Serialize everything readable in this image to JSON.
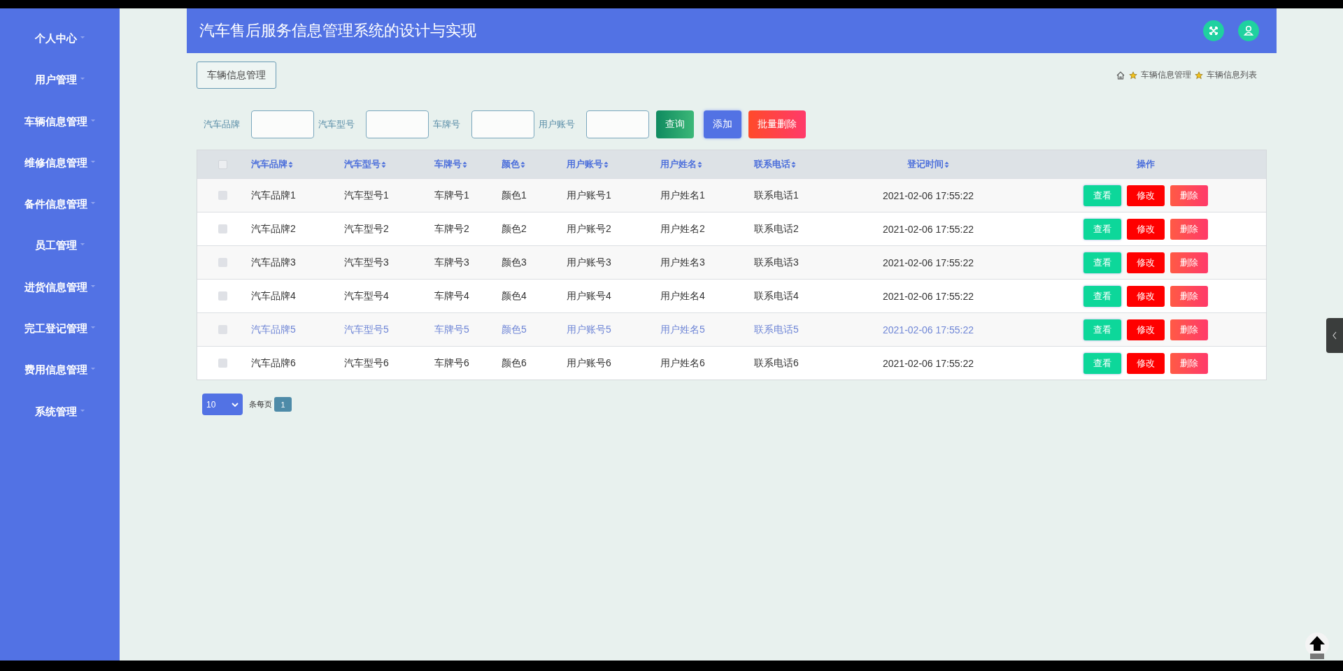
{
  "sidebar": {
    "items": [
      {
        "label": "个人中心"
      },
      {
        "label": "用户管理"
      },
      {
        "label": "车辆信息管理"
      },
      {
        "label": "维修信息管理"
      },
      {
        "label": "备件信息管理"
      },
      {
        "label": "员工管理"
      },
      {
        "label": "进货信息管理"
      },
      {
        "label": "完工登记管理"
      },
      {
        "label": "费用信息管理"
      },
      {
        "label": "系统管理"
      }
    ]
  },
  "header": {
    "title": "汽车售后服务信息管理系统的设计与实现"
  },
  "page_tab": "车辆信息管理",
  "breadcrumb": [
    "车辆信息管理",
    "车辆信息列表"
  ],
  "filters": [
    {
      "label": "汽车品牌"
    },
    {
      "label": "汽车型号"
    },
    {
      "label": "车牌号"
    },
    {
      "label": "用户账号"
    }
  ],
  "buttons": [
    {
      "kind": "search",
      "label": "查询"
    },
    {
      "kind": "add",
      "label": "添加"
    },
    {
      "kind": "delete",
      "label": "批量删除"
    }
  ],
  "table": {
    "checked": false,
    "columns": [
      "汽车品牌",
      "汽车型号",
      "车牌号",
      "颜色",
      "用户账号",
      "用户姓名",
      "联系电话",
      "登记时间",
      "操作"
    ],
    "rows": [
      {
        "checked": false,
        "hovered": false,
        "cells": [
          "汽车品牌1",
          "汽车型号1",
          "车牌号1",
          "颜色1",
          "用户账号1",
          "用户姓名1",
          "联系电话1",
          "2021-02-06 17:55:22"
        ],
        "actions": [
          {
            "kind": "view",
            "label": "查看"
          },
          {
            "kind": "edit",
            "label": "修改"
          },
          {
            "kind": "delete",
            "label": "删除"
          }
        ]
      },
      {
        "checked": false,
        "hovered": false,
        "cells": [
          "汽车品牌2",
          "汽车型号2",
          "车牌号2",
          "颜色2",
          "用户账号2",
          "用户姓名2",
          "联系电话2",
          "2021-02-06 17:55:22"
        ],
        "actions": [
          {
            "kind": "view",
            "label": "查看"
          },
          {
            "kind": "edit",
            "label": "修改"
          },
          {
            "kind": "delete",
            "label": "删除"
          }
        ]
      },
      {
        "checked": false,
        "hovered": false,
        "cells": [
          "汽车品牌3",
          "汽车型号3",
          "车牌号3",
          "颜色3",
          "用户账号3",
          "用户姓名3",
          "联系电话3",
          "2021-02-06 17:55:22"
        ],
        "actions": [
          {
            "kind": "view",
            "label": "查看"
          },
          {
            "kind": "edit",
            "label": "修改"
          },
          {
            "kind": "delete",
            "label": "删除"
          }
        ]
      },
      {
        "checked": false,
        "hovered": false,
        "cells": [
          "汽车品牌4",
          "汽车型号4",
          "车牌号4",
          "颜色4",
          "用户账号4",
          "用户姓名4",
          "联系电话4",
          "2021-02-06 17:55:22"
        ],
        "actions": [
          {
            "kind": "view",
            "label": "查看"
          },
          {
            "kind": "edit",
            "label": "修改"
          },
          {
            "kind": "delete",
            "label": "删除"
          }
        ]
      },
      {
        "checked": false,
        "hovered": true,
        "cells": [
          "汽车品牌5",
          "汽车型号5",
          "车牌号5",
          "颜色5",
          "用户账号5",
          "用户姓名5",
          "联系电话5",
          "2021-02-06 17:55:22"
        ],
        "actions": [
          {
            "kind": "view",
            "label": "查看"
          },
          {
            "kind": "edit",
            "label": "修改"
          },
          {
            "kind": "delete",
            "label": "删除"
          }
        ]
      },
      {
        "checked": false,
        "hovered": false,
        "cells": [
          "汽车品牌6",
          "汽车型号6",
          "车牌号6",
          "颜色6",
          "用户账号6",
          "用户姓名6",
          "联系电话6",
          "2021-02-06 17:55:22"
        ],
        "actions": [
          {
            "kind": "view",
            "label": "查看"
          },
          {
            "kind": "edit",
            "label": "修改"
          },
          {
            "kind": "delete",
            "label": "删除"
          }
        ]
      }
    ]
  },
  "pagination": {
    "page_size": "10",
    "page_size_label": "条每页",
    "pages": [
      {
        "label": "1",
        "selected": true
      }
    ]
  }
}
